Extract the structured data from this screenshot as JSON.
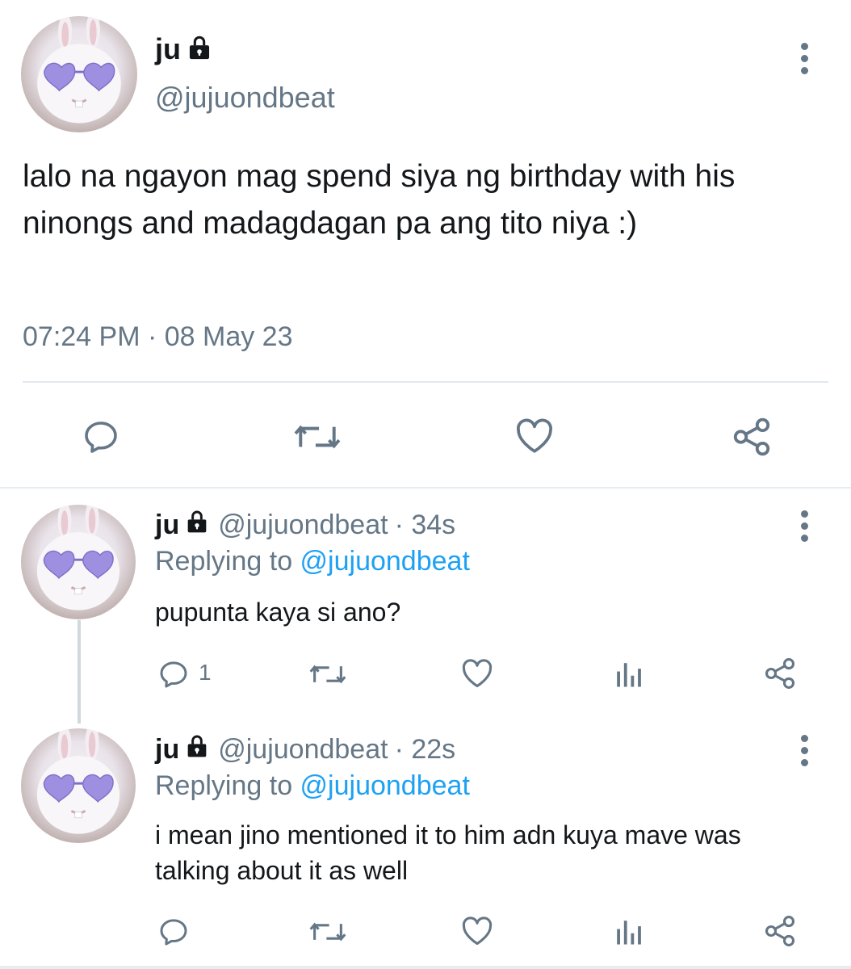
{
  "main_tweet": {
    "name": "ju",
    "handle": "@jujuondbeat",
    "text": "lalo na ngayon mag spend siya ng birthday with his ninongs and madagdagan pa ang tito niya :)",
    "timestamp": "07:24 PM · 08 May 23",
    "icons": [
      "reply-icon",
      "retweet-icon",
      "like-icon",
      "share-icon"
    ]
  },
  "replies": [
    {
      "name": "ju",
      "handle": "@jujuondbeat",
      "time": "· 34s",
      "replying_prefix": "Replying to ",
      "replying_to": "@jujuondbeat",
      "text": "pupunta kaya si ano?",
      "reply_count": "1",
      "icons": [
        "reply-icon",
        "retweet-icon",
        "like-icon",
        "analytics-icon",
        "share-icon"
      ]
    },
    {
      "name": "ju",
      "handle": "@jujuondbeat",
      "time": "· 22s",
      "replying_prefix": "Replying to ",
      "replying_to": "@jujuondbeat",
      "text": "i mean jino mentioned it to him adn kuya mave was talking about it as well",
      "reply_count": "",
      "icons": [
        "reply-icon",
        "retweet-icon",
        "like-icon",
        "analytics-icon",
        "share-icon"
      ]
    }
  ],
  "colors": {
    "text": "#14171a",
    "secondary": "#657786",
    "link": "#1da1f2",
    "divider": "#e1e8ed"
  }
}
